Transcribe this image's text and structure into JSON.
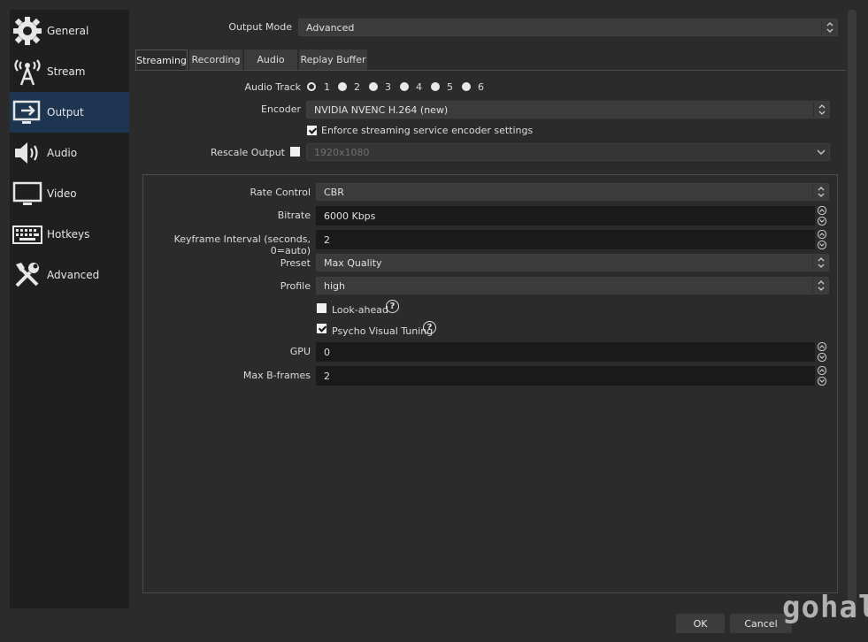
{
  "sidebar": {
    "items": [
      {
        "label": "General",
        "icon": "gear-icon"
      },
      {
        "label": "Stream",
        "icon": "broadcast-antenna-icon"
      },
      {
        "label": "Output",
        "icon": "monitor-output-icon",
        "active": true
      },
      {
        "label": "Audio",
        "icon": "speaker-icon"
      },
      {
        "label": "Video",
        "icon": "monitor-icon"
      },
      {
        "label": "Hotkeys",
        "icon": "keyboard-icon"
      },
      {
        "label": "Advanced",
        "icon": "tools-icon"
      }
    ]
  },
  "output_mode": {
    "label": "Output Mode",
    "value": "Advanced"
  },
  "tabs": [
    "Streaming",
    "Recording",
    "Audio",
    "Replay Buffer"
  ],
  "audio_track": {
    "label": "Audio Track",
    "options": [
      "1",
      "2",
      "3",
      "4",
      "5",
      "6"
    ],
    "selected": "1"
  },
  "encoder": {
    "label": "Encoder",
    "value": "NVIDIA NVENC H.264 (new)"
  },
  "enforce": {
    "label": "Enforce streaming service encoder settings",
    "checked": true
  },
  "rescale": {
    "label": "Rescale Output",
    "value": "1920x1080",
    "checked": false
  },
  "settings": {
    "rate_control": {
      "label": "Rate Control",
      "value": "CBR"
    },
    "bitrate": {
      "label": "Bitrate",
      "value": "6000 Kbps"
    },
    "keyframe": {
      "label": "Keyframe Interval (seconds, 0=auto)",
      "value": "2"
    },
    "preset": {
      "label": "Preset",
      "value": "Max Quality"
    },
    "profile": {
      "label": "Profile",
      "value": "high"
    },
    "lookahead": {
      "label": "Look-ahead",
      "checked": false
    },
    "psycho": {
      "label": "Psycho Visual Tuning",
      "checked": true
    },
    "gpu": {
      "label": "GPU",
      "value": "0"
    },
    "bframes": {
      "label": "Max B-frames",
      "value": "2"
    }
  },
  "buttons": {
    "ok": "OK",
    "cancel": "Cancel"
  },
  "watermark": "gohalu",
  "colors": {
    "active_sidebar": "#1d3550",
    "background": "#2b2b2b"
  }
}
